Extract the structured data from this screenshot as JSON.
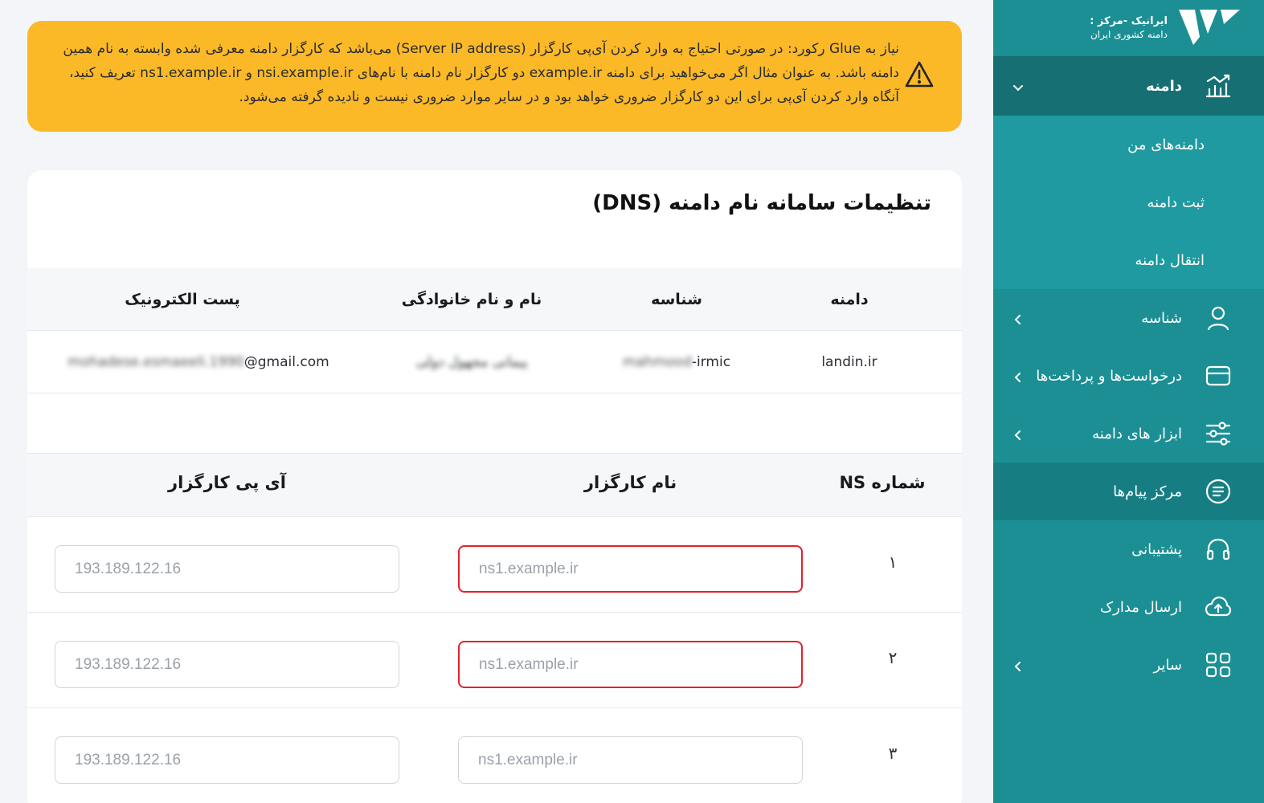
{
  "colors": {
    "sidebar": "#1b8f94",
    "sidebar_active": "#166f73",
    "alert": "#fbb928",
    "error_border": "#e5202a"
  },
  "brand": {
    "line1": "ایرانیک -مرکز :",
    "line2": "دامنه کشوری ایران"
  },
  "sidebar": {
    "domain": "دامنه",
    "sub": [
      "دامنه‌های من",
      "ثبت دامنه",
      "انتقال دامنه"
    ],
    "items": [
      {
        "label": "شناسه",
        "icon": "user-icon"
      },
      {
        "label": "درخواست‌ها و پرداخت‌ها",
        "icon": "card-icon"
      },
      {
        "label": "ابزار های دامنه",
        "icon": "sliders-icon"
      },
      {
        "label": "مرکز پیام‌ها",
        "icon": "message-icon"
      },
      {
        "label": "پشتیبانی",
        "icon": "headset-icon"
      },
      {
        "label": "ارسال مدارک",
        "icon": "cloud-upload-icon"
      },
      {
        "label": "سایر",
        "icon": "grid-icon"
      }
    ]
  },
  "alert": {
    "text": "نیاز به Glue رکورد: در صورتی احتیاج به وارد کردن آی‌پی کارگزار (Server IP address) می‌باشد که کارگزار دامنه معرفی شده وابسته به نام همین دامنه باشد. به عنوان مثال اگر می‌خواهید برای دامنه example.ir دو کارگزار نام دامنه با نام‌های nsi.example.ir و ns1.example.ir تعریف کنید، آنگاه وارد کردن آی‌پی برای این دو کارگزار ضروری خواهد بود و در سایر موارد ضروری نیست و نادیده گرفته می‌شود."
  },
  "card": {
    "title": "تنظیمات سامانه نام دامنه (DNS)"
  },
  "info": {
    "headers": {
      "domain": "دامنه",
      "handle": "شناسه",
      "name": "نام و نام خانوادگی",
      "email": "پست الکترونیک"
    },
    "row": {
      "domain": "landin.ir",
      "handle_blur": "mahmood",
      "handle_suffix": "-irmic",
      "name_blur": "پیمانی مجهول دولی",
      "email_blur": "mohadese.esmaeeli.1990",
      "email_suffix": "@gmail.com"
    }
  },
  "ns": {
    "headers": {
      "num": "شماره NS",
      "server": "نام کارگزار",
      "ip": "آی پی کارگزار"
    },
    "rows": [
      {
        "num": "۱",
        "server_placeholder": "ns1.example.ir",
        "ip_placeholder": "193.189.122.16"
      },
      {
        "num": "۲",
        "server_placeholder": "ns1.example.ir",
        "ip_placeholder": "193.189.122.16"
      },
      {
        "num": "۳",
        "server_placeholder": "ns1.example.ir",
        "ip_placeholder": "193.189.122.16"
      }
    ]
  }
}
